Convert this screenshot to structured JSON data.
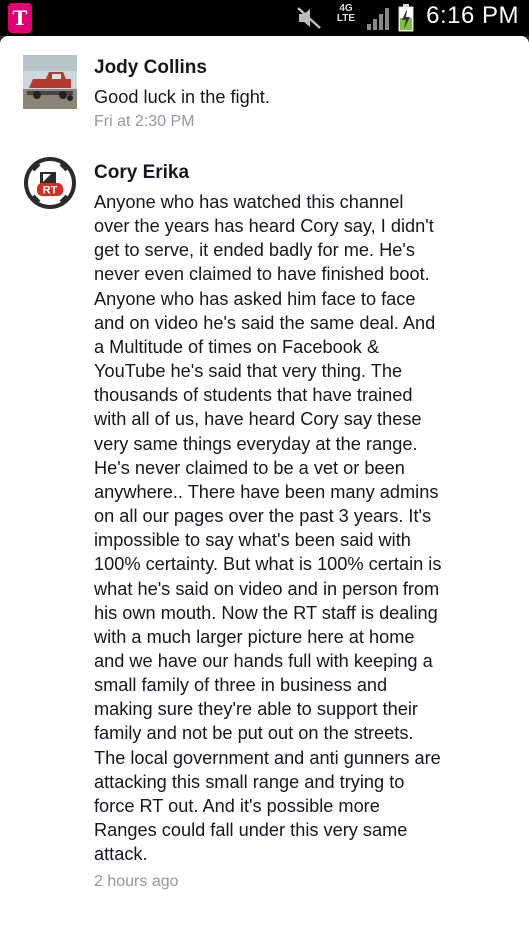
{
  "status_bar": {
    "carrier_logo": "T",
    "network_label": "4G LTE",
    "time": "6:16 PM",
    "icons": [
      "carrier-logo-icon",
      "mute-icon",
      "4g-lte-icon",
      "signal-icon",
      "battery-charging-icon"
    ]
  },
  "comments": [
    {
      "author": "Jody Collins",
      "text": "Good luck in the fight.",
      "timestamp": "Fri at 2:30 PM",
      "avatar": "photo-of-red-truck-on-trailer"
    },
    {
      "author": "Cory Erika",
      "avatar_text": "RT",
      "text": "Anyone who has watched this channel\nover the years has heard Cory say, I didn't\nget to serve, it ended badly for me. He's\nnever even claimed to have finished boot.\nAnyone who has asked him face to face\nand on video he's said the same deal. And\na Multitude of times on Facebook &\nYouTube he's said that very thing. The\nthousands of students that have trained\nwith all of us, have heard Cory say these\nvery same things everyday at the range.\nHe's never claimed to be a vet or been\nanywhere.. There have been many admins\non all our pages over the past 3 years. It's\nimpossible to say what's been said with\n100% certainty. But what is 100% certain is\nwhat he's said on video and in person from\nhis own mouth. Now the RT staff is dealing\nwith a much larger picture here at home\nand we have our hands full with keeping a\nsmall family of three in business and\nmaking sure they're able to support their\nfamily and not be put out on the streets.\nThe local government and anti gunners are\nattacking this small range and trying to\nforce RT out. And it's possible more\nRanges could fall under this very same\nattack.",
      "timestamp": "2 hours ago"
    }
  ]
}
